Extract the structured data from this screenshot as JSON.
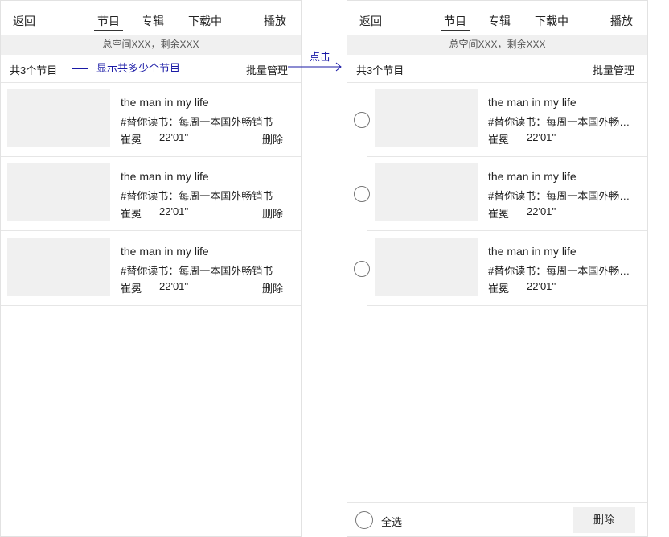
{
  "left_screen": {
    "nav": {
      "back": "返回",
      "tabs": [
        {
          "label": "节目",
          "active": true
        },
        {
          "label": "专辑",
          "active": false
        },
        {
          "label": "下载中",
          "active": false
        }
      ],
      "play": "播放"
    },
    "storage": "总空间XXX，剩余XXX",
    "count": "共3个节目",
    "batch": "批量管理",
    "annotation": "显示共多少个节目",
    "items": [
      {
        "title": "the man in my life",
        "desc": "#替你读书：每周一本国外畅销书",
        "author": "崔冕",
        "duration": "22'01''",
        "delete": "删除"
      },
      {
        "title": "the man in my life",
        "desc": "#替你读书：每周一本国外畅销书",
        "author": "崔冕",
        "duration": "22'01''",
        "delete": "删除"
      },
      {
        "title": "the man in my life",
        "desc": "#替你读书：每周一本国外畅销书",
        "author": "崔冕",
        "duration": "22'01''",
        "delete": "删除"
      }
    ]
  },
  "transition": {
    "label": "点击"
  },
  "right_screen": {
    "nav": {
      "back": "返回",
      "tabs": [
        {
          "label": "节目",
          "active": true
        },
        {
          "label": "专辑",
          "active": false
        },
        {
          "label": "下载中",
          "active": false
        }
      ],
      "play": "播放"
    },
    "storage": "总空间XXX，剩余XXX",
    "count": "共3个节目",
    "batch": "批量管理",
    "items": [
      {
        "title": "the man in my life",
        "desc": "#替你读书：每周一本国外畅销书",
        "author": "崔冕",
        "duration": "22'01''"
      },
      {
        "title": "the man in my life",
        "desc": "#替你读书：每周一本国外畅销书",
        "author": "崔冕",
        "duration": "22'01''"
      },
      {
        "title": "the man in my life",
        "desc": "#替你读书：每周一本国外畅销书",
        "author": "崔冕",
        "duration": "22'01''"
      }
    ],
    "bottom": {
      "select_all": "全选",
      "delete": "删除"
    }
  },
  "colors": {
    "annotation": "#1a1aa6",
    "placeholder": "#f0f0f0",
    "divider": "#e6e6e6"
  }
}
